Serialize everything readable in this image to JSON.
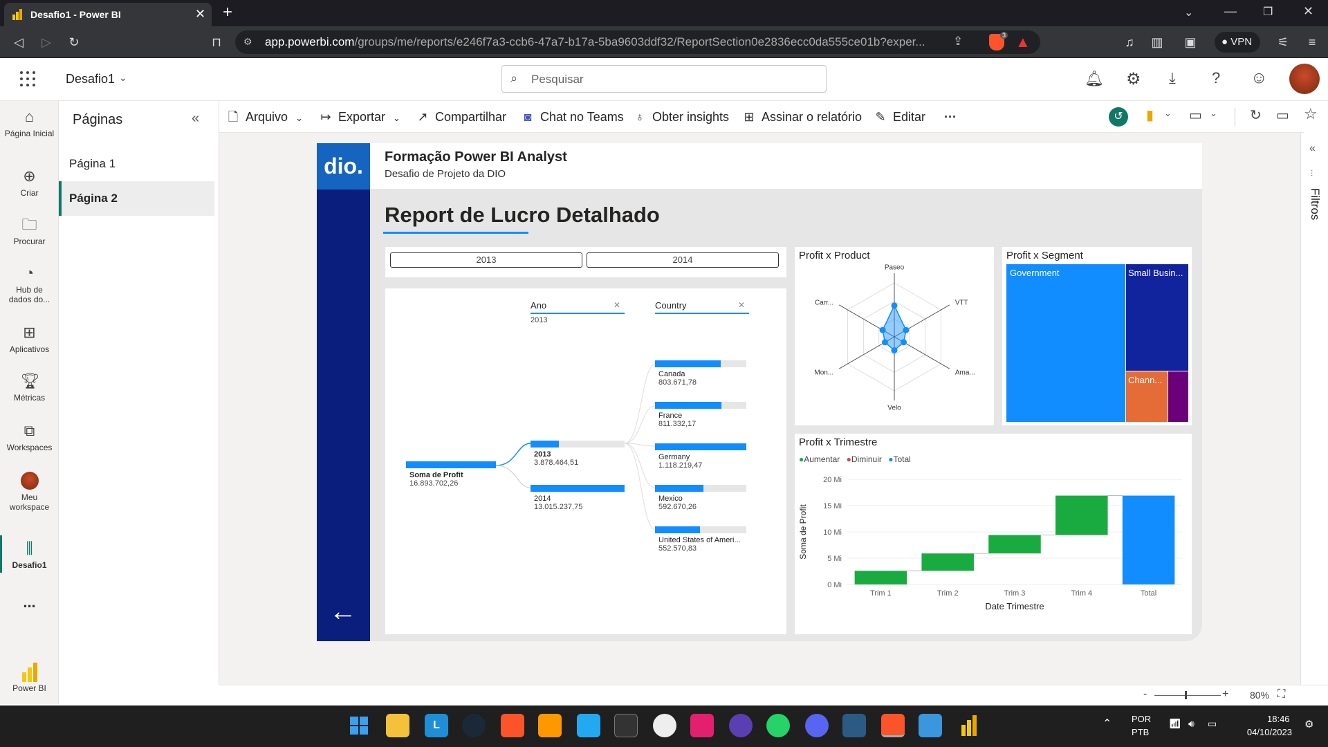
{
  "browser": {
    "tab_title": "Desafio1 - Power BI",
    "url_domain": "app.powerbi.com",
    "url_path": "/groups/me/reports/e246f7a3-ccb6-47a7-b17a-5ba9603ddf32/ReportSection0e2836ecc0da555ce01b?exper...",
    "vpn_label": "VPN",
    "brave_badge": "3"
  },
  "header": {
    "workspace_name": "Desafio1",
    "search_placeholder": "Pesquisar"
  },
  "leftnav": {
    "items": [
      {
        "label": "Página Inicial",
        "icon": "home-icon"
      },
      {
        "label": "Criar",
        "icon": "plus-circle-icon"
      },
      {
        "label": "Procurar",
        "icon": "folder-icon"
      },
      {
        "label": "Hub de dados do...",
        "icon": "data-hub-icon"
      },
      {
        "label": "Aplicativos",
        "icon": "apps-icon"
      },
      {
        "label": "Métricas",
        "icon": "trophy-icon"
      },
      {
        "label": "Workspaces",
        "icon": "workspaces-icon"
      },
      {
        "label": "Meu workspace",
        "icon": "avatar-icon"
      },
      {
        "label": "Desafio1",
        "icon": "report-icon"
      }
    ],
    "more": "...",
    "brand": "Power BI"
  },
  "pages": {
    "title": "Páginas",
    "items": [
      "Página 1",
      "Página 2"
    ],
    "selected": "Página 2"
  },
  "toolbar": {
    "arquivo": "Arquivo",
    "exportar": "Exportar",
    "compartilhar": "Compartilhar",
    "chat_teams": "Chat no Teams",
    "obter_insights": "Obter insights",
    "assinar": "Assinar o relatório",
    "editar": "Editar",
    "more": "···"
  },
  "filters_label": "Filtros",
  "report": {
    "logo_text": "dio.",
    "header_title": "Formação Power BI Analyst",
    "header_subtitle": "Desafio de Projeto da DIO",
    "page_title": "Report de Lucro Detalhado",
    "slicer": [
      "2013",
      "2014"
    ],
    "decomp": {
      "col1_title": "Ano",
      "col1_filter": "2013",
      "col2_title": "Country",
      "root_label": "Soma de Profit",
      "root_value": "16.893.702,26",
      "years": [
        {
          "label": "2013",
          "value": "3.878.464,51",
          "fill": 0.3
        },
        {
          "label": "2014",
          "value": "13.015.237,75",
          "fill": 1.0
        }
      ],
      "countries": [
        {
          "label": "Canada",
          "value": "803.671,78",
          "fill": 0.72
        },
        {
          "label": "France",
          "value": "811.332,17",
          "fill": 0.73
        },
        {
          "label": "Germany",
          "value": "1.118.219,47",
          "fill": 1.0
        },
        {
          "label": "Mexico",
          "value": "592.670,26",
          "fill": 0.53
        },
        {
          "label": "United States of Ameri...",
          "value": "552.570,83",
          "fill": 0.49
        }
      ]
    },
    "radar": {
      "title": "Profit x Product",
      "axes": [
        "Paseo",
        "VTT",
        "Ama...",
        "Velo",
        "Mon...",
        "Carr..."
      ],
      "values": [
        0.58,
        0.25,
        0.2,
        0.25,
        0.2,
        0.25
      ]
    },
    "treemap": {
      "title": "Profit x Segment",
      "labels": [
        "Government",
        "Small Busin...",
        "Chann..."
      ],
      "colors": [
        "#118dff",
        "#12239e",
        "#e66c37",
        "#6b007b"
      ]
    },
    "chart_data": {
      "type": "bar",
      "title": "Profit x Trimestre",
      "legend": [
        "Aumentar",
        "Diminuir",
        "Total"
      ],
      "legend_colors": [
        "#1aab40",
        "#d64554",
        "#118dff"
      ],
      "xlabel": "Date Trimestre",
      "ylabel": "Soma de Profit",
      "yticks": [
        "0 Mi",
        "5 Mi",
        "10 Mi",
        "15 Mi",
        "20 Mi"
      ],
      "ylim": [
        0,
        20
      ],
      "categories": [
        "Trim 1",
        "Trim 2",
        "Trim 3",
        "Trim 4",
        "Total"
      ],
      "waterfall": [
        {
          "start": 0,
          "end": 2.6
        },
        {
          "start": 2.6,
          "end": 5.9
        },
        {
          "start": 5.9,
          "end": 9.4
        },
        {
          "start": 9.4,
          "end": 16.9
        },
        {
          "start": 0,
          "end": 16.9
        }
      ]
    }
  },
  "status": {
    "zoom": "80%"
  },
  "taskbar": {
    "lang1": "POR",
    "lang2": "PTB",
    "time": "18:46",
    "date": "04/10/2023"
  }
}
